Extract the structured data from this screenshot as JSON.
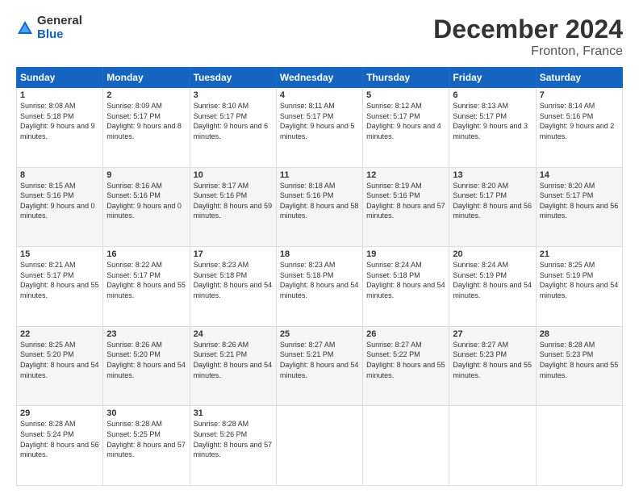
{
  "logo": {
    "general": "General",
    "blue": "Blue"
  },
  "title": "December 2024",
  "subtitle": "Fronton, France",
  "days_of_week": [
    "Sunday",
    "Monday",
    "Tuesday",
    "Wednesday",
    "Thursday",
    "Friday",
    "Saturday"
  ],
  "weeks": [
    [
      {
        "day": "1",
        "sunrise": "8:08 AM",
        "sunset": "5:18 PM",
        "daylight": "9 hours and 9 minutes."
      },
      {
        "day": "2",
        "sunrise": "8:09 AM",
        "sunset": "5:17 PM",
        "daylight": "9 hours and 8 minutes."
      },
      {
        "day": "3",
        "sunrise": "8:10 AM",
        "sunset": "5:17 PM",
        "daylight": "9 hours and 6 minutes."
      },
      {
        "day": "4",
        "sunrise": "8:11 AM",
        "sunset": "5:17 PM",
        "daylight": "9 hours and 5 minutes."
      },
      {
        "day": "5",
        "sunrise": "8:12 AM",
        "sunset": "5:17 PM",
        "daylight": "9 hours and 4 minutes."
      },
      {
        "day": "6",
        "sunrise": "8:13 AM",
        "sunset": "5:17 PM",
        "daylight": "9 hours and 3 minutes."
      },
      {
        "day": "7",
        "sunrise": "8:14 AM",
        "sunset": "5:16 PM",
        "daylight": "9 hours and 2 minutes."
      }
    ],
    [
      {
        "day": "8",
        "sunrise": "8:15 AM",
        "sunset": "5:16 PM",
        "daylight": "9 hours and 0 minutes."
      },
      {
        "day": "9",
        "sunrise": "8:16 AM",
        "sunset": "5:16 PM",
        "daylight": "9 hours and 0 minutes."
      },
      {
        "day": "10",
        "sunrise": "8:17 AM",
        "sunset": "5:16 PM",
        "daylight": "8 hours and 59 minutes."
      },
      {
        "day": "11",
        "sunrise": "8:18 AM",
        "sunset": "5:16 PM",
        "daylight": "8 hours and 58 minutes."
      },
      {
        "day": "12",
        "sunrise": "8:19 AM",
        "sunset": "5:16 PM",
        "daylight": "8 hours and 57 minutes."
      },
      {
        "day": "13",
        "sunrise": "8:20 AM",
        "sunset": "5:17 PM",
        "daylight": "8 hours and 56 minutes."
      },
      {
        "day": "14",
        "sunrise": "8:20 AM",
        "sunset": "5:17 PM",
        "daylight": "8 hours and 56 minutes."
      }
    ],
    [
      {
        "day": "15",
        "sunrise": "8:21 AM",
        "sunset": "5:17 PM",
        "daylight": "8 hours and 55 minutes."
      },
      {
        "day": "16",
        "sunrise": "8:22 AM",
        "sunset": "5:17 PM",
        "daylight": "8 hours and 55 minutes."
      },
      {
        "day": "17",
        "sunrise": "8:23 AM",
        "sunset": "5:18 PM",
        "daylight": "8 hours and 54 minutes."
      },
      {
        "day": "18",
        "sunrise": "8:23 AM",
        "sunset": "5:18 PM",
        "daylight": "8 hours and 54 minutes."
      },
      {
        "day": "19",
        "sunrise": "8:24 AM",
        "sunset": "5:18 PM",
        "daylight": "8 hours and 54 minutes."
      },
      {
        "day": "20",
        "sunrise": "8:24 AM",
        "sunset": "5:19 PM",
        "daylight": "8 hours and 54 minutes."
      },
      {
        "day": "21",
        "sunrise": "8:25 AM",
        "sunset": "5:19 PM",
        "daylight": "8 hours and 54 minutes."
      }
    ],
    [
      {
        "day": "22",
        "sunrise": "8:25 AM",
        "sunset": "5:20 PM",
        "daylight": "8 hours and 54 minutes."
      },
      {
        "day": "23",
        "sunrise": "8:26 AM",
        "sunset": "5:20 PM",
        "daylight": "8 hours and 54 minutes."
      },
      {
        "day": "24",
        "sunrise": "8:26 AM",
        "sunset": "5:21 PM",
        "daylight": "8 hours and 54 minutes."
      },
      {
        "day": "25",
        "sunrise": "8:27 AM",
        "sunset": "5:21 PM",
        "daylight": "8 hours and 54 minutes."
      },
      {
        "day": "26",
        "sunrise": "8:27 AM",
        "sunset": "5:22 PM",
        "daylight": "8 hours and 55 minutes."
      },
      {
        "day": "27",
        "sunrise": "8:27 AM",
        "sunset": "5:23 PM",
        "daylight": "8 hours and 55 minutes."
      },
      {
        "day": "28",
        "sunrise": "8:28 AM",
        "sunset": "5:23 PM",
        "daylight": "8 hours and 55 minutes."
      }
    ],
    [
      {
        "day": "29",
        "sunrise": "8:28 AM",
        "sunset": "5:24 PM",
        "daylight": "8 hours and 56 minutes."
      },
      {
        "day": "30",
        "sunrise": "8:28 AM",
        "sunset": "5:25 PM",
        "daylight": "8 hours and 57 minutes."
      },
      {
        "day": "31",
        "sunrise": "8:28 AM",
        "sunset": "5:26 PM",
        "daylight": "8 hours and 57 minutes."
      },
      null,
      null,
      null,
      null
    ]
  ]
}
